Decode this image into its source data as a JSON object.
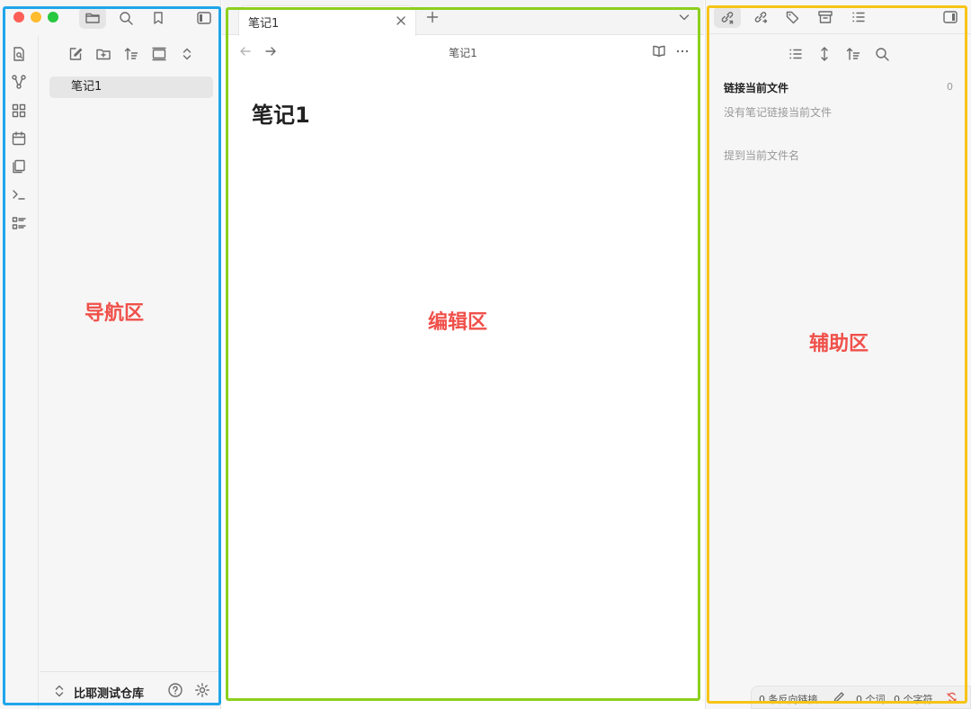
{
  "nav": {
    "top_tabs": [
      "folder-icon",
      "search-icon",
      "bookmark-icon"
    ],
    "sidebar_toggle_icon": "sidebar-left-icon",
    "ribbon_icons": [
      "quick-switcher-icon",
      "graph-icon",
      "canvas-icon",
      "daily-note-icon",
      "templates-icon",
      "command-palette-icon",
      "outline-icon"
    ],
    "file_tools": [
      "new-note-icon",
      "new-folder-icon",
      "sort-icon",
      "collapse-icon",
      "expand-icon"
    ],
    "files": [
      {
        "label": "笔记1"
      }
    ],
    "vault_name": "比耶测试仓库"
  },
  "editor": {
    "tab_title": "笔记1",
    "view_title": "笔记1",
    "doc_title": "笔记1"
  },
  "aux": {
    "top_tabs": [
      "backlinks-icon",
      "outgoing-links-icon",
      "tags-icon",
      "archive-icon",
      "outline-icon"
    ],
    "backlinks_title": "链接当前文件",
    "backlinks_count": "0",
    "backlinks_empty": "没有笔记链接当前文件",
    "unlinked_title": "提到当前文件名"
  },
  "status": {
    "backlinks": "0 条反向链接",
    "words": "0 个词",
    "chars": "0 个字符"
  },
  "annotations": {
    "nav_label": "导航区",
    "editor_label": "编辑区",
    "aux_label": "辅助区"
  },
  "colors": {
    "nav_box": "#1fa5ea",
    "editor_box": "#8ccf1e",
    "aux_box": "#f7c417",
    "annotation_text": "#f0504a"
  }
}
